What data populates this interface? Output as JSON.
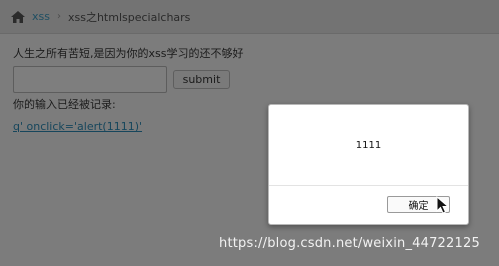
{
  "breadcrumb": {
    "home_icon": "home-icon",
    "link": "xss",
    "separator": "›",
    "current": "xss之htmlspecialchars"
  },
  "intro_text": "人生之所有苦短,是因为你的xss学习的还不够好",
  "form": {
    "input_value": "",
    "input_placeholder": "",
    "submit_label": "submit"
  },
  "log": {
    "label": "你的输入已经被记录:",
    "entry": "q' onclick='alert(1111)'"
  },
  "alert": {
    "message": "1111",
    "ok_label": "确定"
  },
  "watermark": "https://blog.csdn.net/weixin_44722125",
  "colors": {
    "overlay": "#7c7c7c",
    "link": "#16465c",
    "dialog_bg": "#ffffff"
  }
}
